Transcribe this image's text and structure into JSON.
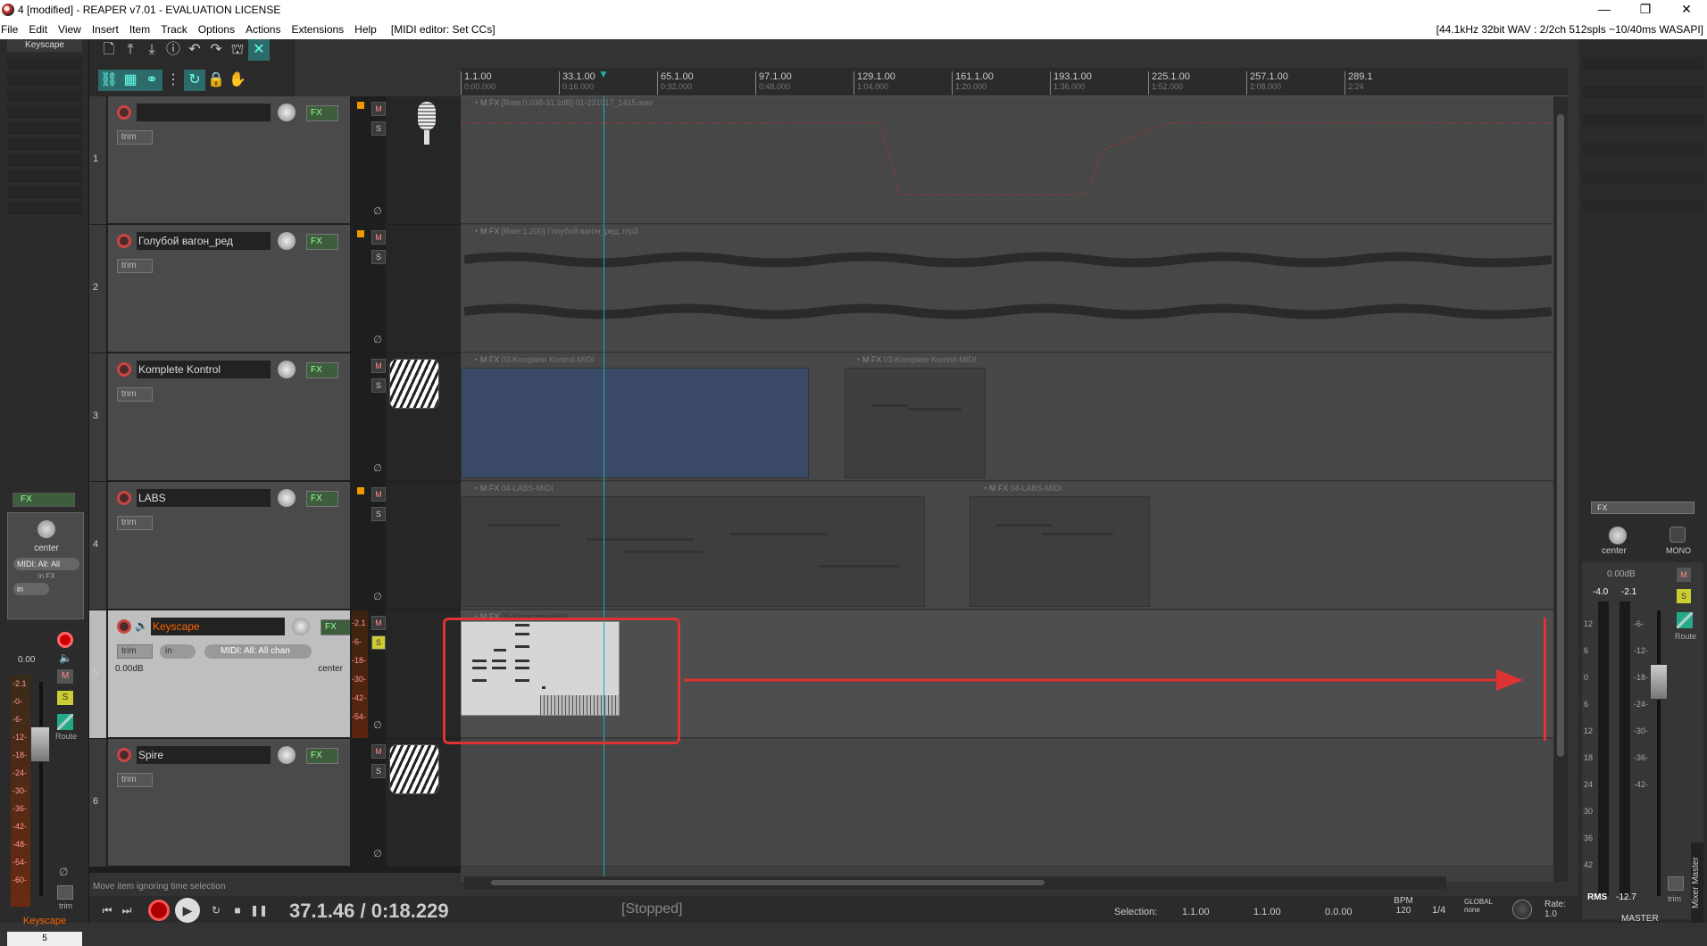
{
  "window": {
    "title": "4 [modified] - REAPER v7.01 - EVALUATION LICENSE",
    "controls": [
      "—",
      "❐",
      "✕"
    ]
  },
  "menu": {
    "items": [
      "File",
      "Edit",
      "View",
      "Insert",
      "Item",
      "Track",
      "Options",
      "Actions",
      "Extensions",
      "Help"
    ],
    "midi_editor": "[MIDI editor: Set CCs]",
    "audio_status": "[44.1kHz 32bit WAV : 2/2ch 512spls ~10/40ms WASAPI]"
  },
  "left_mixer": {
    "top_name": "Keyscape",
    "fx_label": "FX",
    "pan_label": "center",
    "midi_input": "MIDI: All: All",
    "in_fx": "in FX",
    "input": "in",
    "volume": "0.00",
    "meter_scale": [
      "-2.1",
      "-0-",
      "-6-",
      "-12-",
      "-18-",
      "-24-",
      "-30-",
      "-36-",
      "-42-",
      "-48-",
      "-54-",
      "-60-"
    ],
    "mute": "M",
    "solo": "S",
    "route": "Route",
    "trim": "trim",
    "track_name": "Keyscape",
    "track_number": "5"
  },
  "tracks": [
    {
      "num": "1",
      "name": "",
      "fx": "FX",
      "trim": "trim",
      "mute": "M",
      "solo": "S",
      "icon": "microphone-icon"
    },
    {
      "num": "2",
      "name": "Голубой вагон_ред",
      "fx": "FX",
      "trim": "trim",
      "mute": "M",
      "solo": "S",
      "icon": ""
    },
    {
      "num": "3",
      "name": "Komplete Kontrol",
      "fx": "FX",
      "trim": "trim",
      "mute": "M",
      "solo": "S",
      "icon": "piano-icon"
    },
    {
      "num": "4",
      "name": "LABS",
      "fx": "FX",
      "trim": "trim",
      "mute": "M",
      "solo": "S",
      "icon": ""
    },
    {
      "num": "5",
      "name": "Keyscape",
      "fx": "FX",
      "trim": "trim",
      "input": "in",
      "midi": "MIDI: All: All chan",
      "vol": "0.00dB",
      "pan": "center",
      "mute": "M",
      "solo": "S",
      "meter_scale": [
        "-2.1",
        "-6-",
        "-18-",
        "-30-",
        "-42-",
        "-54-"
      ]
    },
    {
      "num": "6",
      "name": "Spire",
      "fx": "FX",
      "trim": "trim",
      "mute": "M",
      "solo": "S",
      "icon": "piano-icon"
    }
  ],
  "ruler": [
    {
      "bar": "1.1.00",
      "time": "0:00.000"
    },
    {
      "bar": "33.1.00",
      "time": "0:16.000"
    },
    {
      "bar": "65.1.00",
      "time": "0:32.000"
    },
    {
      "bar": "97.1.00",
      "time": "0:48.000"
    },
    {
      "bar": "129.1.00",
      "time": "1:04.000"
    },
    {
      "bar": "161.1.00",
      "time": "1:20.000"
    },
    {
      "bar": "193.1.00",
      "time": "1:36.000"
    },
    {
      "bar": "225.1.00",
      "time": "1:52.000"
    },
    {
      "bar": "257.1.00",
      "time": "2:08.000"
    },
    {
      "bar": "289.1",
      "time": "2:24"
    }
  ],
  "items": {
    "track1": "[Rate:0.038-31.2dB] 01-231017_1415.wav",
    "track2": "[Rate:1.200] Голубой вагон_ред..mp3",
    "track3a": "03-Komplete Kontrol-MIDI",
    "track3b": "03-Komplete Kontrol-MIDI",
    "track4a": "04-LABS-MIDI",
    "track4b": "04-LABS-MIDI",
    "track5": "05-Keyscape-MIDI"
  },
  "master": {
    "fx_label": "FX",
    "pan_label": "center",
    "mono_label": "MONO",
    "db": "0.00dB",
    "peak_l": "-4.0",
    "peak_r": "-2.1",
    "scale_l": [
      "12",
      "6",
      "0",
      "6",
      "12",
      "18",
      "24",
      "30",
      "36",
      "42"
    ],
    "scale_r": [
      "-6-",
      "-12-",
      "-18-",
      "-24-",
      "-30-",
      "-36-",
      "-42-"
    ],
    "mute": "M",
    "solo": "S",
    "route": "Route",
    "trim": "trim",
    "rms_label": "RMS",
    "rms_value": "-12.7",
    "name": "MASTER",
    "mixer_tab": "Mixer Master"
  },
  "transport": {
    "status_message": "Move item ignoring time selection",
    "time": "37.1.46 / 0:18.229",
    "state": "[Stopped]",
    "selection_label": "Selection:",
    "sel_start": "1.1.00",
    "sel_end": "1.1.00",
    "sel_len": "0.0.00",
    "bpm_label": "BPM",
    "bpm": "120",
    "signature": "1/4",
    "global": "GLOBAL",
    "global_mode": "none",
    "rate_label": "Rate:",
    "rate": "1.0"
  },
  "colors": {
    "annotation": "#d33",
    "playhead": "#22aaaa",
    "selected_track_name": "#ff6600"
  }
}
